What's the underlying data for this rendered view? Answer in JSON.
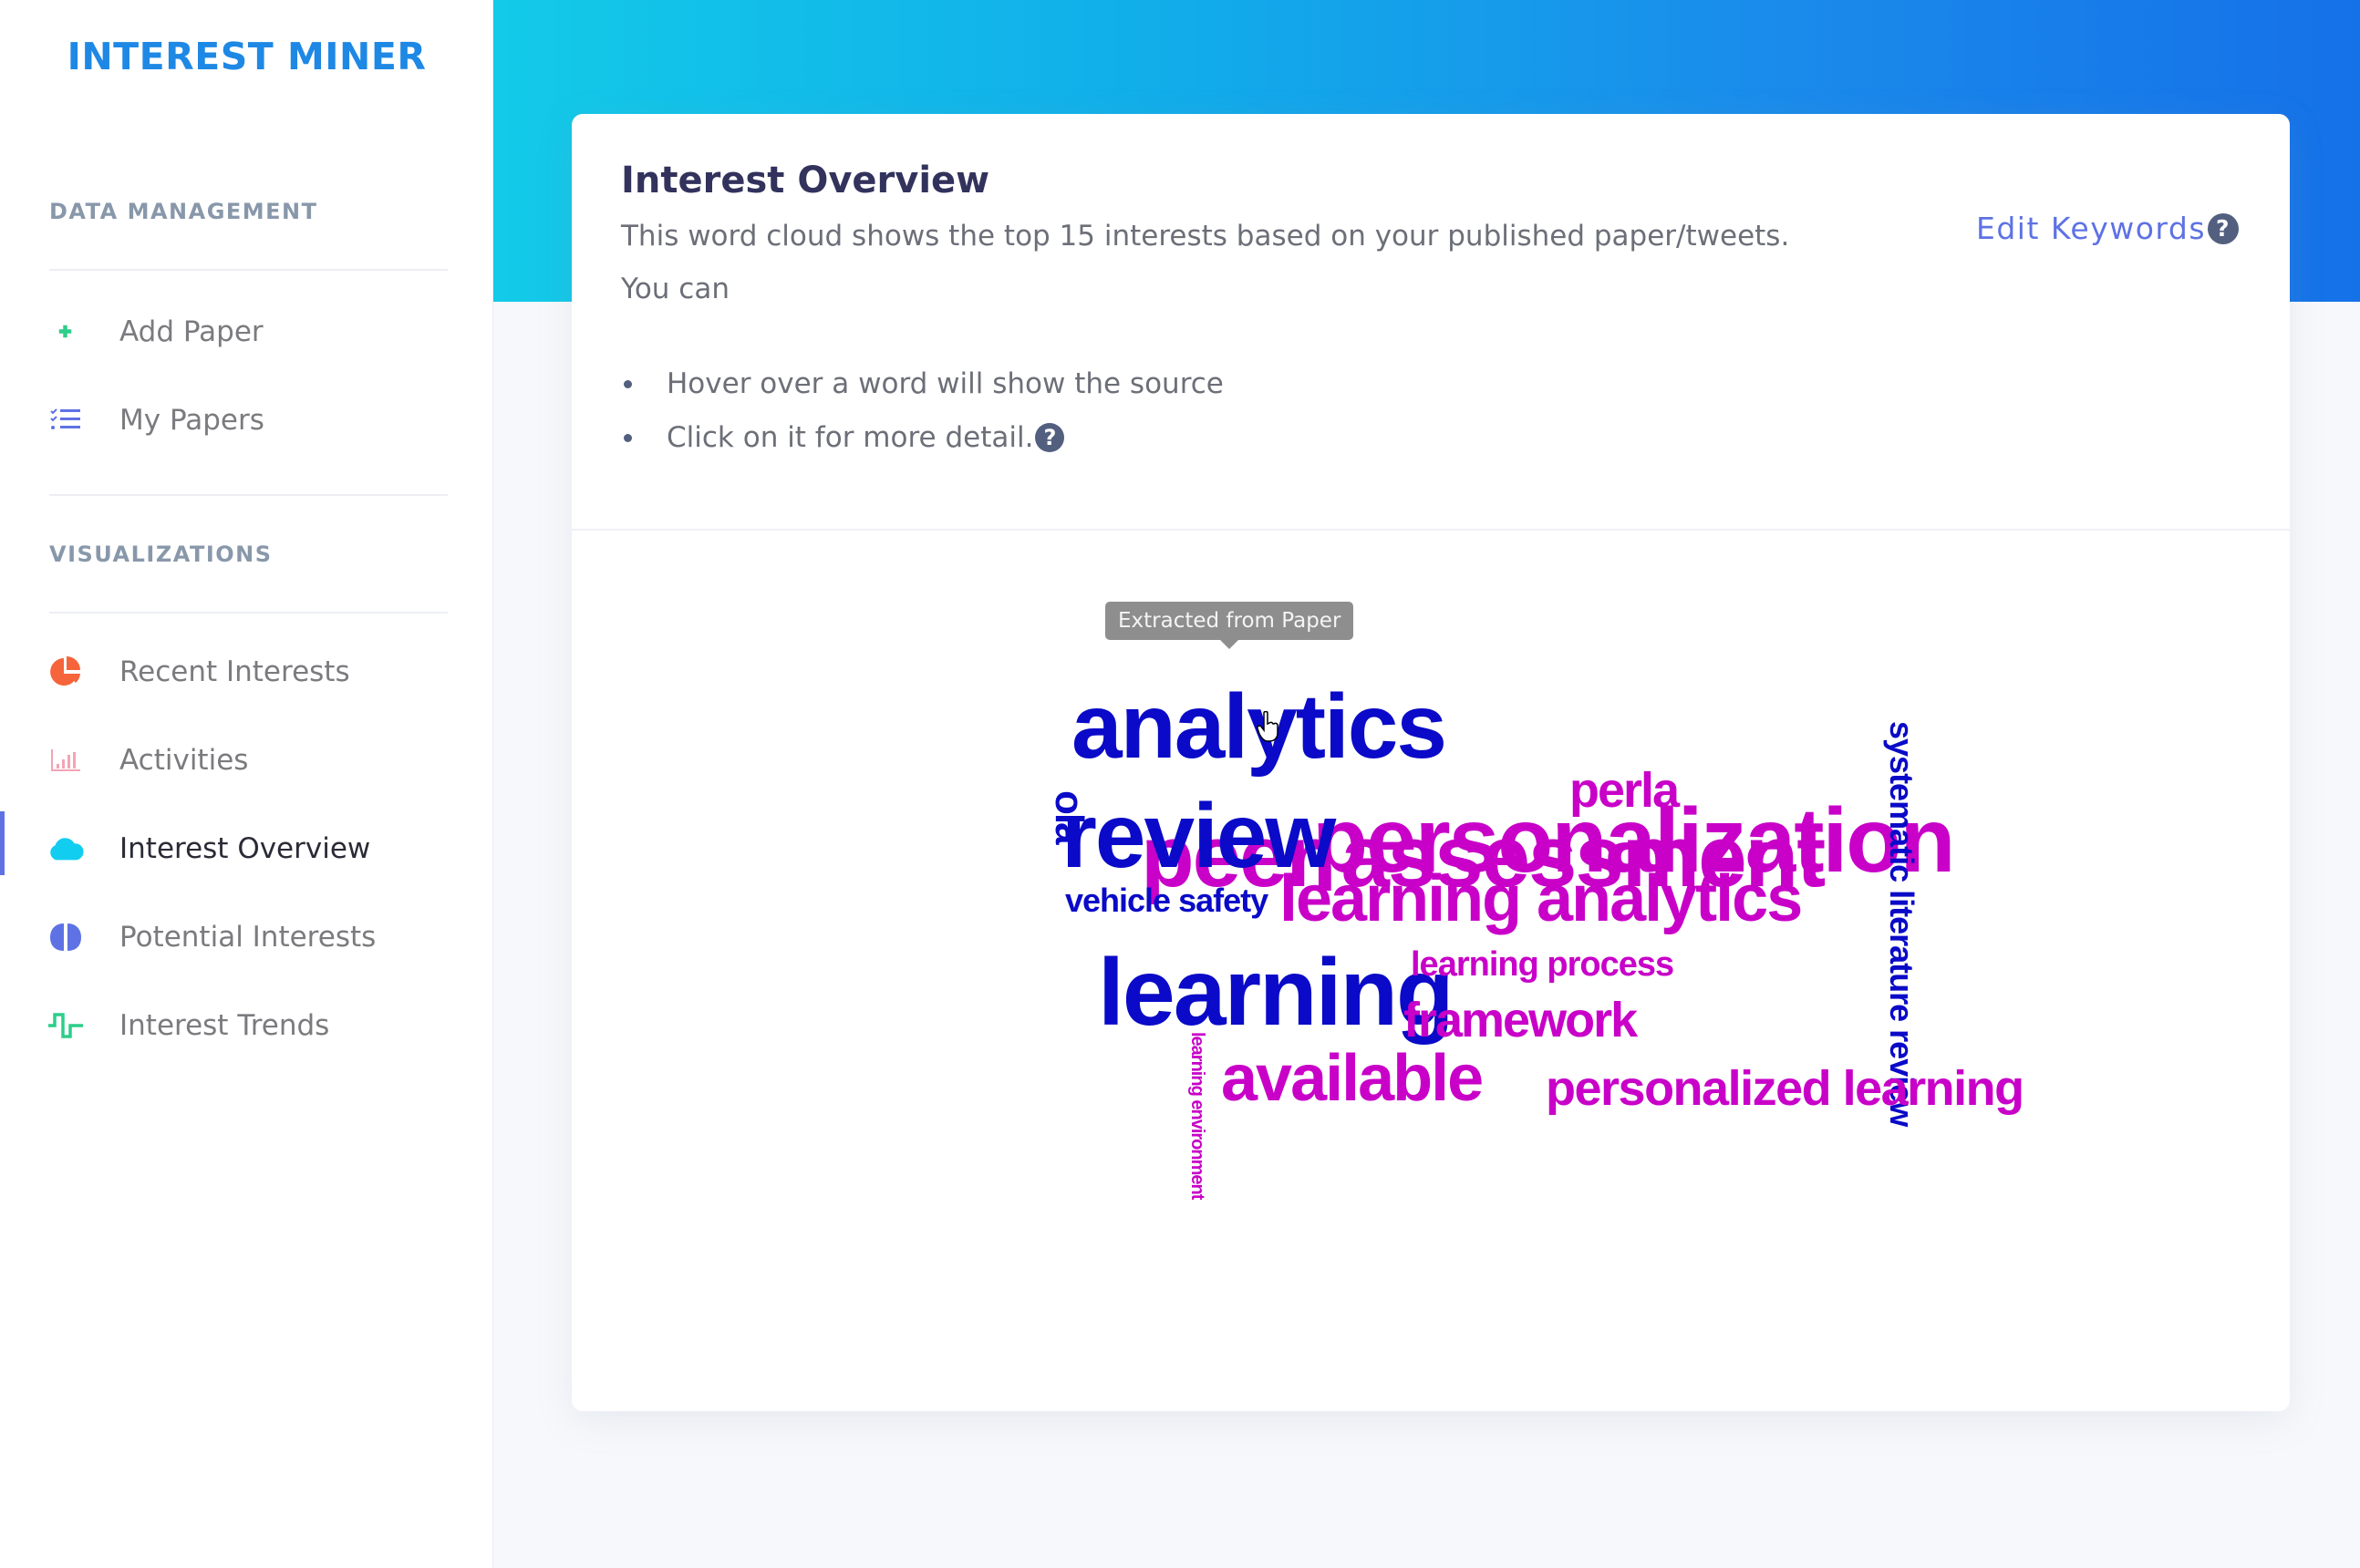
{
  "app": {
    "title": "INTEREST MINER"
  },
  "sidebar": {
    "sections": [
      {
        "title": "DATA MANAGEMENT",
        "items": [
          {
            "label": "Add Paper",
            "icon": "plus-icon",
            "color": "#2dce89"
          },
          {
            "label": "My Papers",
            "icon": "list-check-icon",
            "color": "#5e72e4"
          }
        ]
      },
      {
        "title": "VISUALIZATIONS",
        "items": [
          {
            "label": "Recent Interests",
            "icon": "pie-chart-icon",
            "color": "#f5643a"
          },
          {
            "label": "Activities",
            "icon": "bar-chart-icon",
            "color": "#f3a4b5"
          },
          {
            "label": "Interest Overview",
            "icon": "cloud-icon",
            "color": "#11cdef",
            "active": true
          },
          {
            "label": "Potential Interests",
            "icon": "brain-icon",
            "color": "#5e72e4"
          },
          {
            "label": "Interest Trends",
            "icon": "trend-wave-icon",
            "color": "#2dce89"
          }
        ]
      }
    ]
  },
  "card": {
    "title": "Interest Overview",
    "description": "This word cloud shows the top 15 interests based on your published paper/tweets.",
    "you_can": "You can",
    "bullets": [
      "Hover over a word will show the source",
      "Click on it for more detail."
    ],
    "edit_keywords": "Edit Keywords",
    "help_glyph": "?"
  },
  "word_cloud": {
    "tooltip": "Extracted from Paper",
    "colors": {
      "paper": "#0a0ac8",
      "tweet": "#c800c8"
    },
    "words": [
      {
        "text": "analytics",
        "color": "paper"
      },
      {
        "text": "ola",
        "color": "paper",
        "rotated": true
      },
      {
        "text": "review",
        "color": "paper"
      },
      {
        "text": "peer assessment",
        "color": "tweet"
      },
      {
        "text": "personalization",
        "color": "tweet"
      },
      {
        "text": "perla",
        "color": "tweet"
      },
      {
        "text": "systematic literature review",
        "color": "paper",
        "rotated": true
      },
      {
        "text": "vehicle safety",
        "color": "paper"
      },
      {
        "text": "learning analytics",
        "color": "tweet"
      },
      {
        "text": "learning",
        "color": "paper"
      },
      {
        "text": "learning process",
        "color": "tweet"
      },
      {
        "text": "framework",
        "color": "tweet"
      },
      {
        "text": "learning environment",
        "color": "tweet",
        "rotated": true
      },
      {
        "text": "available",
        "color": "tweet"
      },
      {
        "text": "personalized learning",
        "color": "tweet"
      }
    ]
  }
}
